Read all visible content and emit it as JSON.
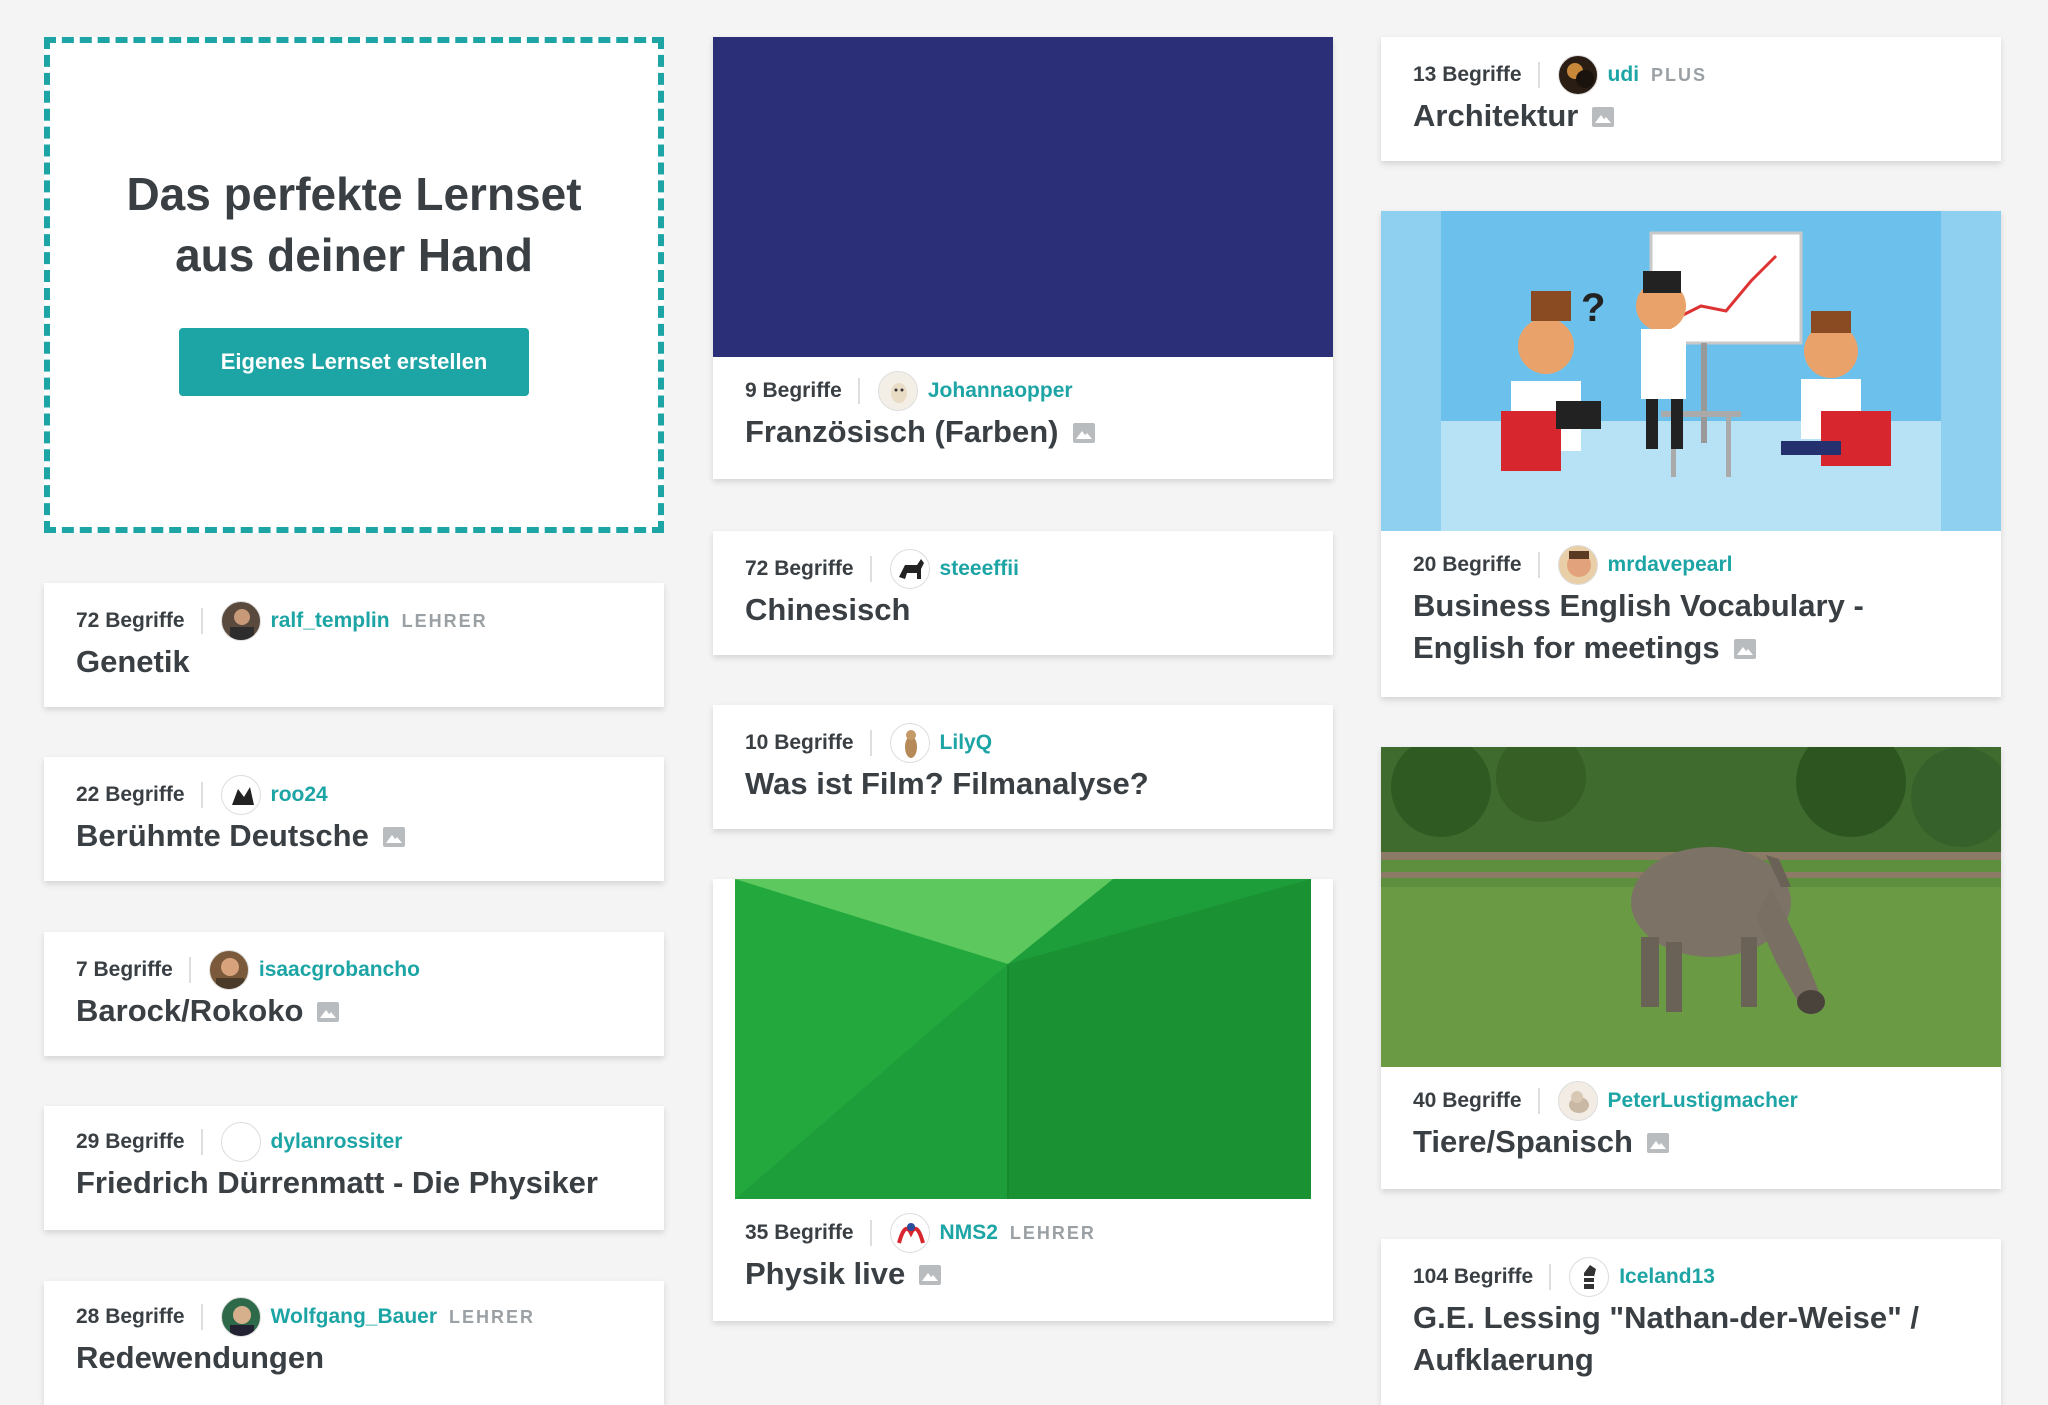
{
  "promo": {
    "title": "Das perfekte Lernset aus deiner Hand",
    "button": "Eigenes Lernset erstellen"
  },
  "colors": {
    "accent": "#1da4a5",
    "text": "#3a3f44",
    "navy_thumb": "#2b2f78",
    "green_thumb": "#1e9e3a"
  },
  "cards": {
    "genetik": {
      "count": "72 Begriffe",
      "user": "ralf_templin",
      "badge": "LEHRER",
      "title": "Genetik",
      "avatar_icon": "man-portrait-icon"
    },
    "deutsche": {
      "count": "22 Begriffe",
      "user": "roo24",
      "title": "Berühmte Deutsche",
      "avatar_icon": "animal-silhouette-icon"
    },
    "barock": {
      "count": "7 Begriffe",
      "user": "isaacgrobancho",
      "title": "Barock/Rokoko",
      "avatar_icon": "person-photo-icon"
    },
    "physiker": {
      "count": "29 Begriffe",
      "user": "dylanrossiter",
      "title": "Friedrich Dürrenmatt - Die Physiker",
      "avatar_icon": "empty-avatar-icon"
    },
    "redewendungen": {
      "count": "28 Begriffe",
      "user": "Wolfgang_Bauer",
      "badge": "LEHRER",
      "title": "Redewendungen",
      "avatar_icon": "globe-avatar-icon"
    },
    "farben": {
      "count": "9 Begriffe",
      "user": "Johannaopper",
      "title": "Französisch (Farben)",
      "avatar_icon": "dog-avatar-icon"
    },
    "chinesisch": {
      "count": "72 Begriffe",
      "user": "steeeffii",
      "title": "Chinesisch",
      "avatar_icon": "dog-silhouette-icon"
    },
    "film": {
      "count": "10 Begriffe",
      "user": "LilyQ",
      "title": "Was ist Film? Filmanalyse?",
      "avatar_icon": "meerkat-avatar-icon"
    },
    "physik": {
      "count": "35 Begriffe",
      "user": "NMS2",
      "badge": "LEHRER",
      "title": "Physik live",
      "avatar_icon": "logo-avatar-icon"
    },
    "architektur": {
      "count": "13 Begriffe",
      "user": "udi",
      "badge": "PLUS",
      "title": "Architektur",
      "avatar_icon": "dark-avatar-icon"
    },
    "business": {
      "count": "20 Begriffe",
      "user": "mrdavepearl",
      "title": "Business English Vocabulary - English for meetings",
      "avatar_icon": "man-smiling-icon"
    },
    "tiere": {
      "count": "40 Begriffe",
      "user": "PeterLustigmacher",
      "title": "Tiere/Spanisch",
      "avatar_icon": "cat-avatar-icon"
    },
    "lessing": {
      "count": "104 Begriffe",
      "user": "Iceland13",
      "title": "G.E. Lessing \"Nathan-der-Weise\" / Aufklaerung",
      "avatar_icon": "zebra-avatar-icon"
    }
  }
}
